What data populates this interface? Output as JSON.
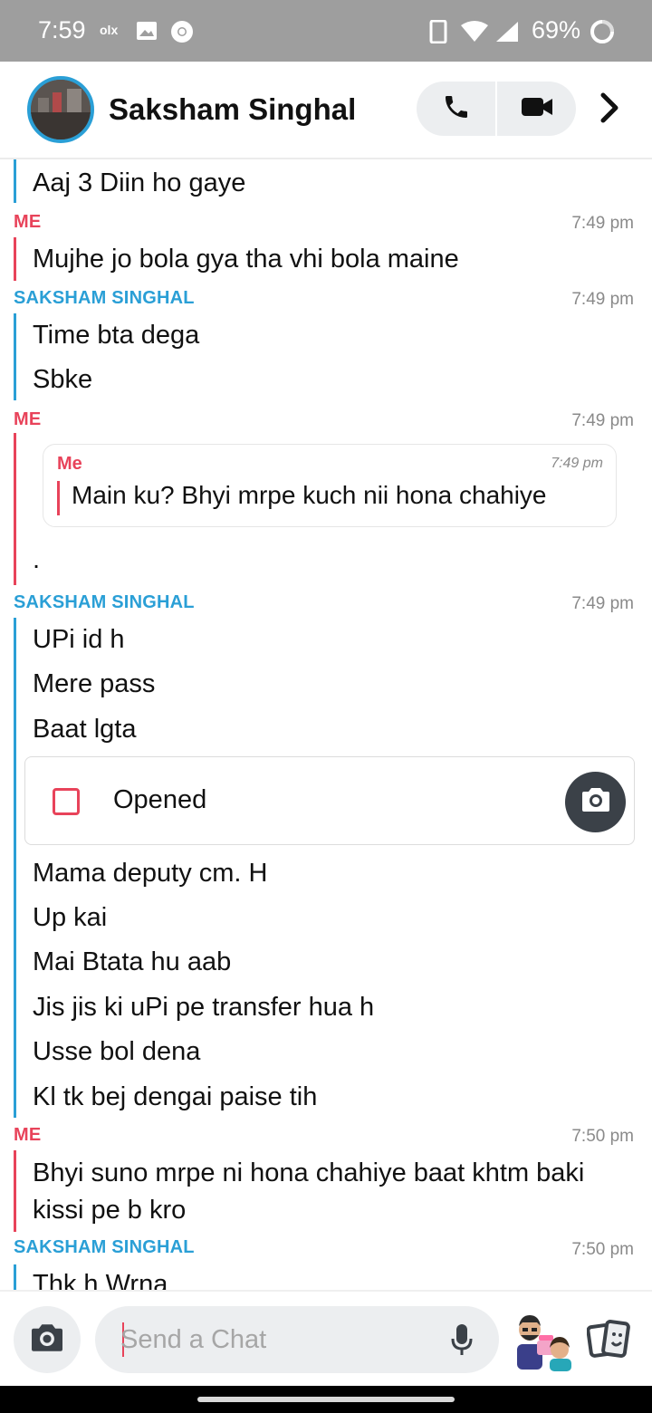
{
  "status_bar": {
    "time": "7:59",
    "battery": "69%",
    "icons": [
      "olx-icon",
      "image-icon",
      "chrome-icon",
      "vibrate-icon",
      "wifi-icon",
      "signal-icon",
      "battery-icon"
    ]
  },
  "header": {
    "contact_name": "Saksham Singhal",
    "call_icon": "phone-icon",
    "video_icon": "video-call-icon",
    "more_icon": "chevron-right-icon"
  },
  "chat": {
    "groups": [
      {
        "sender": "",
        "time": "",
        "side": "them",
        "messages": [
          "Aaj 3 Diin ho gaye"
        ]
      },
      {
        "sender": "ME",
        "time": "7:49 pm",
        "side": "me",
        "messages": [
          "Mujhe jo bola gya tha vhi bola maine"
        ]
      },
      {
        "sender": "SAKSHAM SINGHAL",
        "time": "7:49 pm",
        "side": "them",
        "messages": [
          "Time bta dega",
          "Sbke"
        ]
      },
      {
        "sender": "ME",
        "time": "7:49 pm",
        "side": "me",
        "quote": {
          "sender": "Me",
          "time": "7:49 pm",
          "text": "Main ku? Bhyi mrpe kuch nii hona chahiye"
        },
        "messages": [
          "."
        ]
      },
      {
        "sender": "SAKSHAM SINGHAL",
        "time": "7:49 pm",
        "side": "them",
        "messages": [
          "UPi id h",
          "Mere pass",
          "Baat lgta"
        ],
        "snap": {
          "status": "Opened",
          "icon": "camera-icon"
        },
        "messages_after": [
          "Mama deputy cm. H",
          "Up kai",
          "Mai Btata hu aab",
          "Jis jis ki uPi pe transfer hua h",
          "Usse bol dena",
          "Kl tk bej dengai paise tih"
        ]
      },
      {
        "sender": "ME",
        "time": "7:50 pm",
        "side": "me",
        "messages": [
          "Bhyi suno mrpe ni hona chahiye baat khtm baki",
          "kissi pe b kro"
        ]
      },
      {
        "sender": "SAKSHAM SINGHAL",
        "time": "7:50 pm",
        "side": "them",
        "messages": [
          "Thk h Wrna"
        ]
      }
    ]
  },
  "composer": {
    "placeholder": "Send a Chat",
    "camera_icon": "camera-icon",
    "mic_icon": "microphone-icon",
    "bitmoji_icon": "bitmoji-icon",
    "cards_icon": "cards-icon"
  },
  "colors": {
    "me": "#e8435a",
    "them": "#2a9fd6",
    "status_bar": "#9e9e9e",
    "pill_bg": "#eceef0"
  }
}
